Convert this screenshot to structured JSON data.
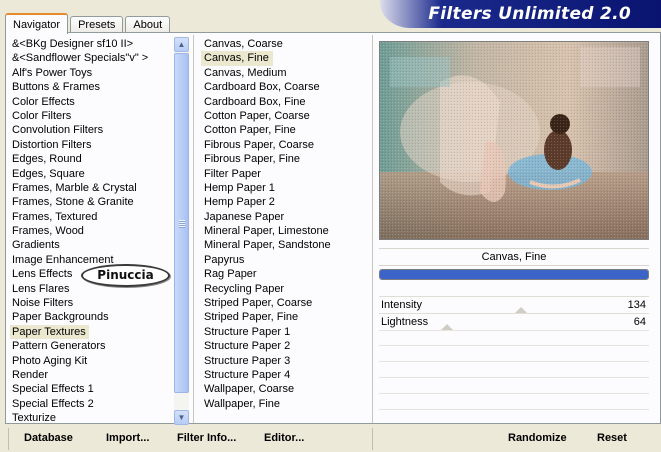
{
  "tabs": [
    "Navigator",
    "Presets",
    "About"
  ],
  "banner_title": "Filters Unlimited 2.0",
  "categories": [
    "&<BKg Designer sf10 II>",
    "&<Sandflower Specials\"v\" >",
    "Alf's Power Toys",
    "Buttons & Frames",
    "Color Effects",
    "Color Filters",
    "Convolution Filters",
    "Distortion Filters",
    "Edges, Round",
    "Edges, Square",
    "Frames, Marble & Crystal",
    "Frames, Stone & Granite",
    "Frames, Textured",
    "Frames, Wood",
    "Gradients",
    "Image Enhancement",
    "Lens Effects",
    "Lens Flares",
    "Noise Filters",
    "Paper Backgrounds",
    "Paper Textures",
    "Pattern Generators",
    "Photo Aging Kit",
    "Render",
    "Special Effects 1",
    "Special Effects 2",
    "Texturize"
  ],
  "selected_category": "Paper Textures",
  "filters": [
    "Canvas, Coarse",
    "Canvas, Fine",
    "Canvas, Medium",
    "Cardboard Box, Coarse",
    "Cardboard Box, Fine",
    "Cotton Paper, Coarse",
    "Cotton Paper, Fine",
    "Fibrous Paper, Coarse",
    "Fibrous Paper, Fine",
    "Filter Paper",
    "Hemp Paper 1",
    "Hemp Paper 2",
    "Japanese Paper",
    "Mineral Paper, Limestone",
    "Mineral Paper, Sandstone",
    "Papyrus",
    "Rag Paper",
    "Recycling Paper",
    "Striped Paper, Coarse",
    "Striped Paper, Fine",
    "Structure Paper 1",
    "Structure Paper 2",
    "Structure Paper 3",
    "Structure Paper 4",
    "Wallpaper, Coarse",
    "Wallpaper, Fine"
  ],
  "selected_filter": "Canvas, Fine",
  "current_filter_name": "Canvas, Fine",
  "progress": 1.0,
  "params": [
    {
      "name": "Intensity",
      "value": "134",
      "level": 0.525
    },
    {
      "name": "Lightness",
      "value": "64",
      "level": 0.25
    }
  ],
  "watermark": "Pinuccia",
  "buttons": {
    "database": "Database",
    "import": "Import...",
    "filter_info": "Filter Info...",
    "editor": "Editor...",
    "randomize": "Randomize",
    "reset": "Reset"
  },
  "colors": {
    "selected_bg": "#ebe8cf",
    "banner_blue": "#0a1470",
    "progress_fill": "#3c64c8"
  }
}
